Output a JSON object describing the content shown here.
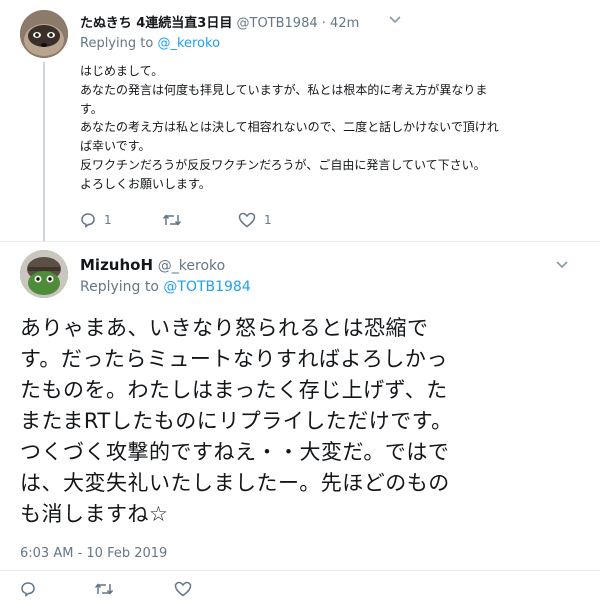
{
  "tweet1": {
    "name": "たぬきち 4連続当直3日目",
    "handle": "@TOTB1984",
    "time": "42m",
    "replying_prefix": "Replying to",
    "replying_handle": "@_keroko",
    "lines": [
      "はじめまして。",
      "あなたの発言は何度も拝見していますが、私とは根本的に考え方が異なりま",
      "す。",
      "あなたの考え方は私とは決して相容れないので、二度と話しかけないで頂けれ",
      "ば幸いです。",
      "反ワクチンだろうが反反ワクチンだろうが、ご自由に発言していて下さい。",
      "よろしくお願いします。"
    ],
    "reply_count": "1",
    "like_count": "1"
  },
  "tweet2": {
    "name": "MizuhoH",
    "handle": "@_keroko",
    "replying_prefix": "Replying to",
    "replying_handle": "@TOTB1984",
    "lines": [
      "ありゃまあ、いきなり怒られるとは恐縮で",
      "す。だったらミュートなりすればよろしかっ",
      "たものを。わたしはまったく存じ上げず、た",
      "またまRTしたものにリプライしただけです。",
      "つくづく攻撃的ですねえ・・大変だ。ではで",
      "は、大変失礼いたしましたー。先ほどのもの",
      "も消しますね☆"
    ],
    "timestamp": "6:03 AM - 10 Feb 2019"
  },
  "colors": {
    "link": "#1da1f2",
    "muted": "#657786",
    "text": "#14171a"
  }
}
